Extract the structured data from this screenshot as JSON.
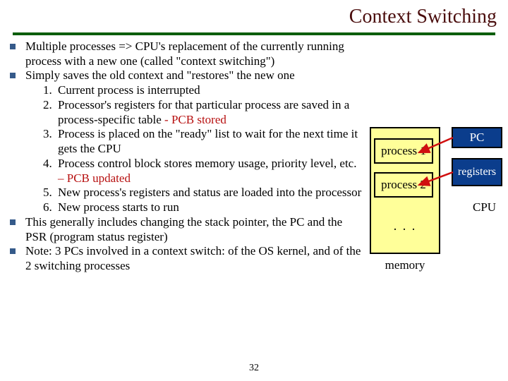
{
  "title": "Context Switching",
  "bullets": {
    "b1": "Multiple processes => CPU's replacement of the currently running process with a new one (called \"context switching\")",
    "b2_lead": "Simply saves the old context and \"restores\" the new one",
    "steps": {
      "s1": "Current process is interrupted",
      "s2_a": "Processor's registers for that particular process are saved in a process-specific table  ",
      "s2_b": "- PCB stored",
      "s3": "Process is placed on the \"ready\" list to wait for the next time it gets the CPU",
      "s4_a": "Process control block stores memory usage, priority level, etc. ",
      "s4_b": "– PCB updated",
      "s5": "New process's registers and status are loaded into the processor",
      "s6": "New process starts to run"
    },
    "b3": "This generally includes changing the stack pointer, the PC and the PSR (program status register)",
    "b4": "Note: 3 PCs involved in a context switch: of the OS kernel, and of the 2 switching processes"
  },
  "diagram": {
    "process1": "process 1",
    "process2": "process 2",
    "dots": ". . .",
    "memory": "memory",
    "pc": "PC",
    "registers": "registers",
    "cpu": "CPU"
  },
  "page_number": "32",
  "colors": {
    "title": "#4a0d0d",
    "rule": "#0c5e0c",
    "bullet_square": "#355a8a",
    "red_text": "#b71010",
    "mem_fill": "#ffff99",
    "cpu_fill": "#0b3d8c",
    "arrow": "#d01010"
  }
}
